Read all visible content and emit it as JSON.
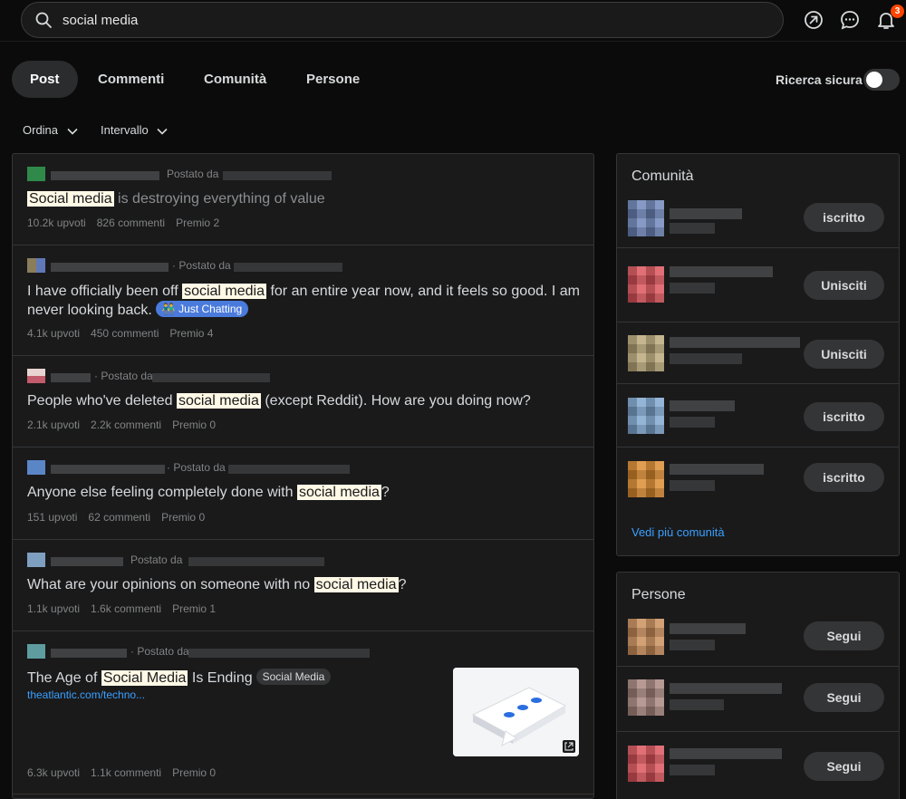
{
  "search": {
    "value": "social media"
  },
  "header": {
    "notification_count": "3"
  },
  "tabs": [
    {
      "label": "Post"
    },
    {
      "label": "Commenti"
    },
    {
      "label": "Comunità"
    },
    {
      "label": "Persone"
    }
  ],
  "safe_search": {
    "label": "Ricerca sicura",
    "enabled": false
  },
  "sort": {
    "order_label": "Ordina",
    "interval_label": "Intervallo"
  },
  "posts": [
    {
      "posted_by": "Postato da",
      "title_hl": "Social media",
      "title_after": " is destroying everything of value",
      "visited": true,
      "upvotes": "10.2k upvoti",
      "comments": "826 commenti",
      "awards": "Premio 2"
    },
    {
      "posted_by": "· Postato da",
      "title_before": "I have officially been off ",
      "title_hl": "social media",
      "title_after": " for an entire year now, and it feels so good. I am never looking back.",
      "flair": "Just Chatting",
      "upvotes": "4.1k upvoti",
      "comments": "450 commenti",
      "awards": "Premio 4"
    },
    {
      "posted_by": "· Postato da",
      "title_before": "People who've deleted ",
      "title_hl": "social media",
      "title_after": " (except Reddit). How are you doing now?",
      "upvotes": "2.1k upvoti",
      "comments": "2.2k commenti",
      "awards": "Premio 0"
    },
    {
      "posted_by": "· Postato da",
      "title_before": "Anyone else feeling completely done with ",
      "title_hl": "social media",
      "title_after": "?",
      "upvotes": "151 upvoti",
      "comments": "62 commenti",
      "awards": "Premio 0"
    },
    {
      "posted_by": "Postato da",
      "title_before": "What are your opinions on someone with no ",
      "title_hl": "social media",
      "title_after": "?",
      "upvotes": "1.1k upvoti",
      "comments": "1.6k commenti",
      "awards": "Premio 1"
    },
    {
      "posted_by": "· Postato da",
      "title_before": "The Age of ",
      "title_hl": "Social Media",
      "title_after": " Is Ending",
      "flair": "Social Media",
      "link": "theatlantic.com/techno...",
      "upvotes": "6.3k upvoti",
      "comments": "1.1k commenti",
      "awards": "Premio 0"
    }
  ],
  "communities": {
    "title": "Comunità",
    "items": [
      {
        "button": "iscritto",
        "avatar_color": "#6d86b8"
      },
      {
        "button": "Unisciti",
        "avatar_color": "#d9535a"
      },
      {
        "button": "Unisciti",
        "avatar_color": "#b8a778"
      },
      {
        "button": "iscritto",
        "avatar_color": "#7fa6cf"
      },
      {
        "button": "iscritto",
        "avatar_color": "#d98a2e"
      }
    ],
    "more_link": "Vedi più comunità"
  },
  "people": {
    "title": "Persone",
    "items": [
      {
        "button": "Segui",
        "avatar_color": "#c98d5a"
      },
      {
        "button": "Segui",
        "avatar_color": "#a8867e"
      },
      {
        "button": "Segui",
        "avatar_color": "#d9535a"
      }
    ]
  },
  "colors": {
    "accent": "#3aa0ff",
    "badge": "#ff4500",
    "flair_blue": "#4a7bdc"
  }
}
